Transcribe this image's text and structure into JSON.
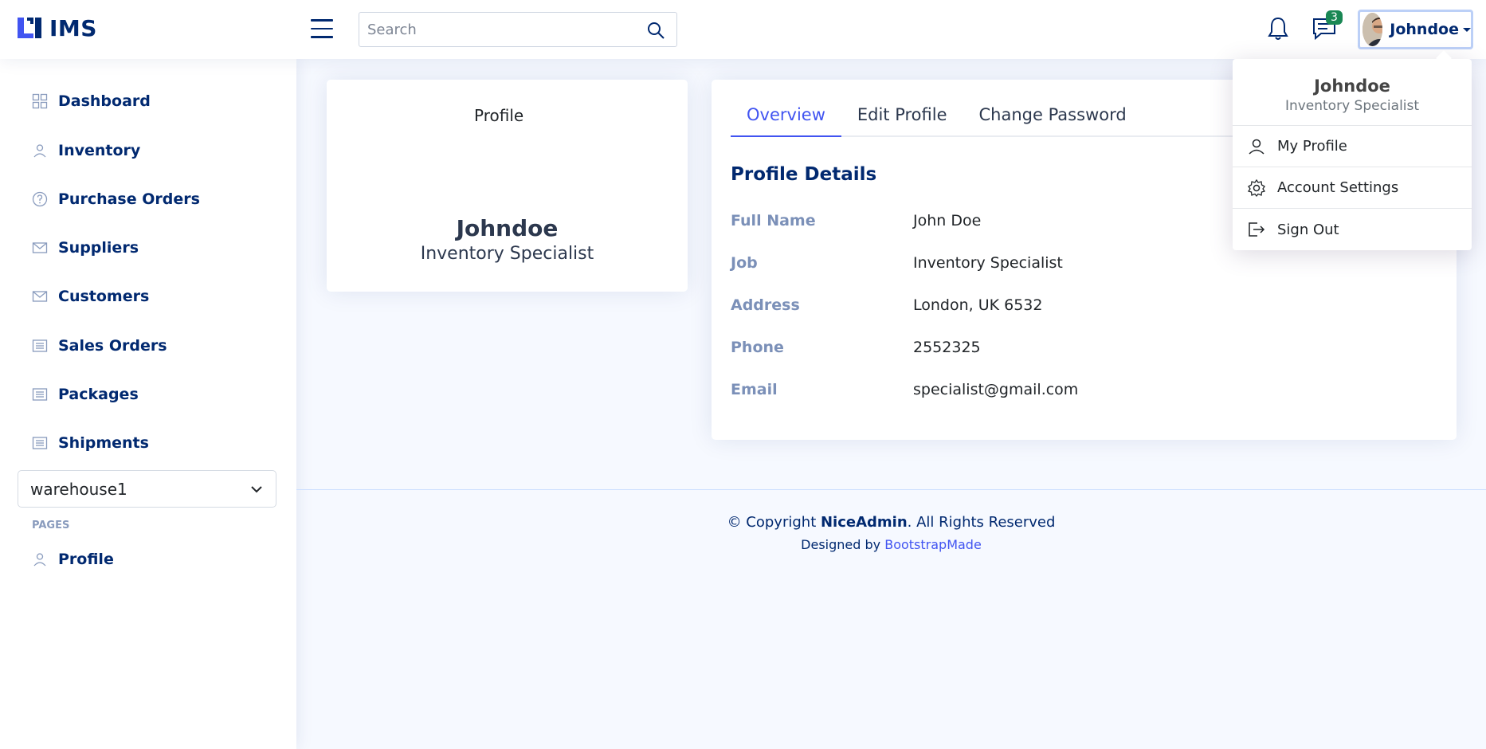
{
  "header": {
    "logo_text": "IMS",
    "search_placeholder": "Search",
    "messages_badge": "3",
    "user_name": "Johndoe"
  },
  "user_menu": {
    "name": "Johndoe",
    "role": "Inventory Specialist",
    "items": [
      {
        "label": "My Profile",
        "icon": "person-icon"
      },
      {
        "label": "Account Settings",
        "icon": "gear-icon"
      },
      {
        "label": "Sign Out",
        "icon": "sign-out-icon"
      }
    ]
  },
  "sidebar": {
    "items": [
      {
        "label": "Dashboard",
        "icon": "grid-icon"
      },
      {
        "label": "Inventory",
        "icon": "person-icon"
      },
      {
        "label": "Purchase Orders",
        "icon": "question-circle-icon"
      },
      {
        "label": "Suppliers",
        "icon": "envelope-icon"
      },
      {
        "label": "Customers",
        "icon": "envelope-icon"
      },
      {
        "label": "Sales Orders",
        "icon": "list-icon"
      },
      {
        "label": "Packages",
        "icon": "list-icon"
      },
      {
        "label": "Shipments",
        "icon": "list-icon"
      }
    ],
    "warehouse_selected": "warehouse1",
    "pages_heading": "PAGES",
    "pages_items": [
      {
        "label": "Profile",
        "icon": "person-icon"
      }
    ]
  },
  "profile_card": {
    "image_alt": "Profile",
    "name": "Johndoe",
    "role": "Inventory Specialist"
  },
  "tabs": [
    {
      "label": "Overview",
      "active": true
    },
    {
      "label": "Edit Profile",
      "active": false
    },
    {
      "label": "Change Password",
      "active": false
    }
  ],
  "details": {
    "title": "Profile Details",
    "rows": [
      {
        "label": "Full Name",
        "value": "John Doe"
      },
      {
        "label": "Job",
        "value": "Inventory Specialist"
      },
      {
        "label": "Address",
        "value": "London, UK 6532"
      },
      {
        "label": "Phone",
        "value": "2552325"
      },
      {
        "label": "Email",
        "value": "specialist@gmail.com"
      }
    ]
  },
  "footer": {
    "copyright_prefix": "© Copyright ",
    "brand": "NiceAdmin",
    "copyright_suffix": ". All Rights Reserved",
    "designed_prefix": "Designed by ",
    "designer": "BootstrapMade"
  },
  "colors": {
    "primary": "#012970",
    "accent": "#4154f1",
    "badge": "#198754",
    "background": "#f6f9ff"
  }
}
